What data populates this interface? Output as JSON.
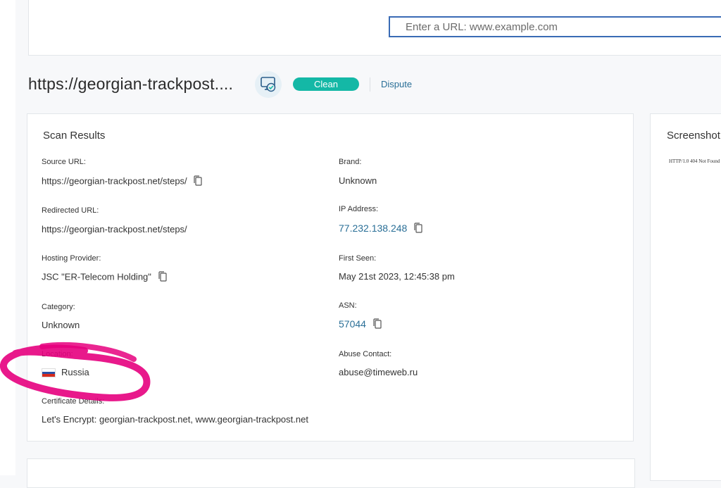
{
  "search": {
    "placeholder": "Enter a URL: www.example.com"
  },
  "header": {
    "site_title": "https://georgian-trackpost....",
    "status_badge": "Clean",
    "dispute_label": "Dispute"
  },
  "scan_results": {
    "title": "Scan Results",
    "fields": {
      "source_url": {
        "label": "Source URL:",
        "value": "https://georgian-trackpost.net/steps/"
      },
      "redirected_url": {
        "label": "Redirected URL:",
        "value": "https://georgian-trackpost.net/steps/"
      },
      "hosting_provider": {
        "label": "Hosting Provider:",
        "value": "JSC \"ER-Telecom Holding\""
      },
      "category": {
        "label": "Category:",
        "value": "Unknown"
      },
      "location": {
        "label": "Location:",
        "value": "Russia"
      },
      "certificate": {
        "label": "Certificate Details:",
        "value": "Let's Encrypt: georgian-trackpost.net, www.georgian-trackpost.net"
      },
      "brand": {
        "label": "Brand:",
        "value": "Unknown"
      },
      "ip_address": {
        "label": "IP Address:",
        "value": "77.232.138.248"
      },
      "first_seen": {
        "label": "First Seen:",
        "value": "May 21st 2023, 12:45:38 pm"
      },
      "asn": {
        "label": "ASN:",
        "value": "57044"
      },
      "abuse_contact": {
        "label": "Abuse Contact:",
        "value": "abuse@timeweb.ru"
      }
    }
  },
  "screenshot": {
    "title": "Screenshot",
    "content_text": "HTTP/1.0 404 Not Found"
  },
  "colors": {
    "accent_teal": "#14b8a6",
    "link_blue": "#2a6f97",
    "annotation_magenta": "#e6007e",
    "input_border": "#3a6bb5"
  },
  "icons": [
    "scan-monitor-check-icon",
    "copy-icon",
    "russia-flag-icon"
  ]
}
